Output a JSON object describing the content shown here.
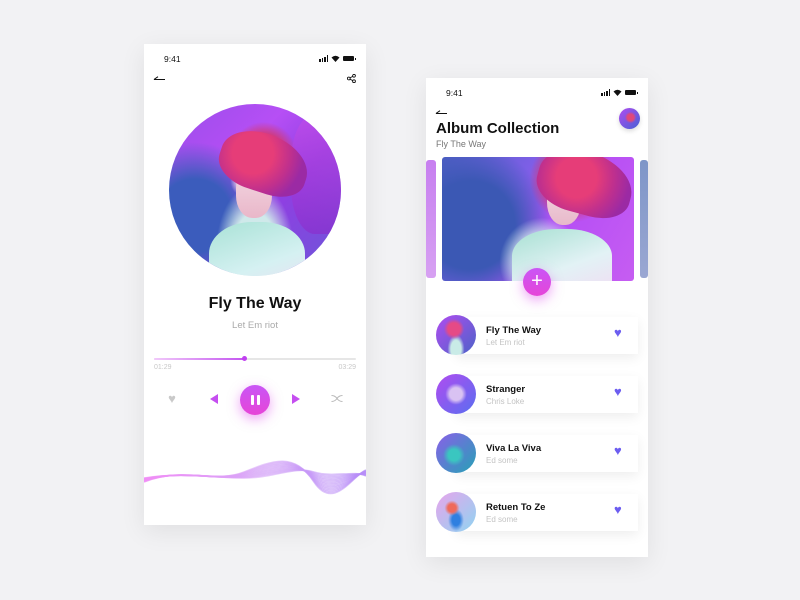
{
  "player": {
    "status_time": "9:41",
    "song_title": "Fly The Way",
    "artist": "Let Em riot",
    "progress": 0.45,
    "current_time": "01:29",
    "total_time": "03:29",
    "icons": {
      "back": "back-arrow-icon",
      "share": "share-icon",
      "like": "heart-icon",
      "prev": "previous-icon",
      "play_pause": "pause-icon",
      "next": "next-icon",
      "shuffle": "shuffle-icon"
    }
  },
  "collection": {
    "status_time": "9:41",
    "title": "Album Collection",
    "subtitle": "Fly The Way",
    "add_label": "+",
    "songs": [
      {
        "title": "Fly The Way",
        "artist": "Let Em riot"
      },
      {
        "title": "Stranger",
        "artist": "Chris Loke"
      },
      {
        "title": "Viva La Viva",
        "artist": "Ed some"
      },
      {
        "title": "Retuen To Ze",
        "artist": "Ed some"
      }
    ]
  },
  "colors": {
    "accent": "#c956f6",
    "accent_alt": "#e645d8",
    "favorite": "#6c5df0",
    "background": "#f2f2f4"
  }
}
